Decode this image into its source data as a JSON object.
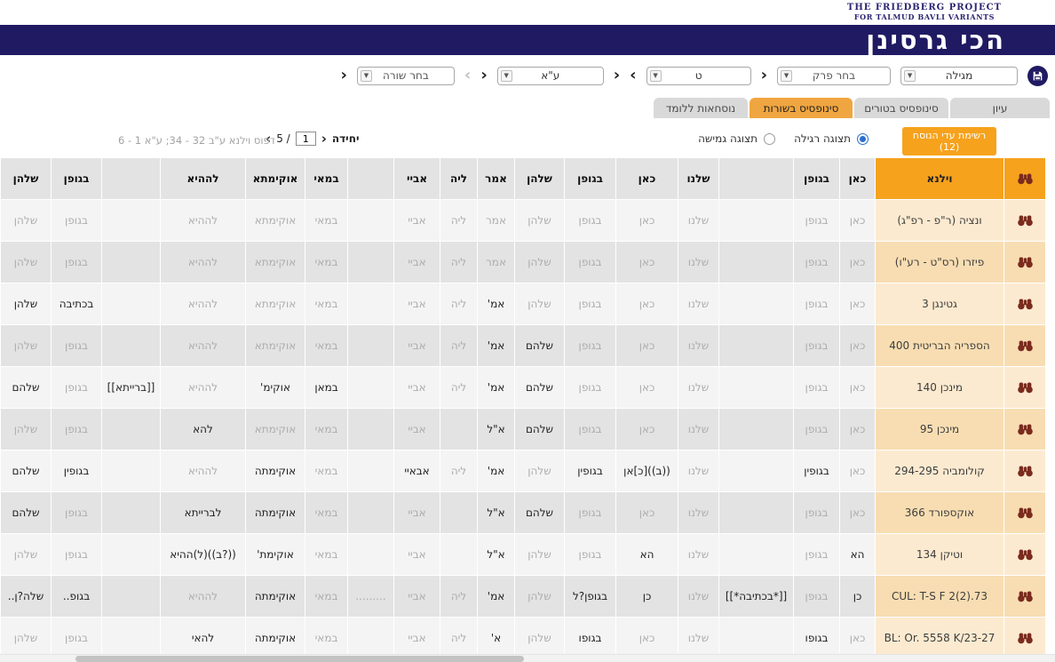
{
  "logo": {
    "line1": "THE FRIEDBERG PROJECT",
    "line2": "FOR TALMUD BAVLI VARIANTS"
  },
  "header": {
    "title": "הכי גרסינן"
  },
  "icons": {
    "chevron_left": "‹",
    "chevron_right": "›",
    "caret_down": "▼"
  },
  "toolbar": {
    "tractate": "מגילה",
    "chapter": "בחר פרק",
    "daf": "ט",
    "amud": "ע\"א",
    "line": "בחר שורה"
  },
  "tabs": [
    {
      "label": "עיון",
      "active": false
    },
    {
      "label": "סינופסיס בטורים",
      "active": false
    },
    {
      "label": "סינופסיס בשורות",
      "active": true
    },
    {
      "label": "נוסחאות ללומד",
      "active": false
    }
  ],
  "controls": {
    "witnesses_button_label": "רשימת עדי הנוסח",
    "witnesses_count": "(12)",
    "view_regular": "תצוגה רגילה",
    "view_flexible": "תצוגה גמישה",
    "view_selected": "regular",
    "unit_label": "יחידה",
    "unit_value": "1",
    "unit_total": "/ 5",
    "print_ref": "דפוס וילנא  ע\"ב 32 - 34; ע\"א 1 - 6"
  },
  "colors": {
    "navy": "#201a63",
    "orange": "#f6a21d",
    "tab_active": "#f0a640",
    "binoculars_maroon": "#7a2b1e"
  },
  "table": {
    "rows": [
      {
        "name": "וילנא",
        "base": true,
        "cells": [
          [
            "כאן",
            1
          ],
          [
            "בגופן",
            1
          ],
          [
            "",
            0
          ],
          [
            "שלנו",
            1
          ],
          [
            "כאן",
            1
          ],
          [
            "בגופן",
            1
          ],
          [
            "שלהן",
            1
          ],
          [
            "אמר",
            1
          ],
          [
            "ליה",
            1
          ],
          [
            "אביי",
            1
          ],
          [
            "",
            0
          ],
          [
            "במאי",
            1
          ],
          [
            "אוקימתא",
            1
          ],
          [
            "לההיא",
            1
          ],
          [
            "",
            0
          ],
          [
            "בגופן",
            1
          ],
          [
            "שלהן",
            1
          ]
        ]
      },
      {
        "name": "ונציה (ר\"פ - רפ\"ג)",
        "cells": [
          [
            "כאן",
            0
          ],
          [
            "בגופן",
            0
          ],
          [
            "",
            0
          ],
          [
            "שלנו",
            0
          ],
          [
            "כאן",
            0
          ],
          [
            "בגופן",
            0
          ],
          [
            "שלהן",
            0
          ],
          [
            "אמר",
            0
          ],
          [
            "ליה",
            0
          ],
          [
            "אביי",
            0
          ],
          [
            "",
            0
          ],
          [
            "במאי",
            0
          ],
          [
            "אוקימתא",
            0
          ],
          [
            "לההיא",
            0
          ],
          [
            "",
            0
          ],
          [
            "בגופן",
            0
          ],
          [
            "שלהן",
            0
          ]
        ]
      },
      {
        "name": "פיזרו (רס\"ט - רע\"ו)",
        "cells": [
          [
            "כאן",
            0
          ],
          [
            "בגופן",
            0
          ],
          [
            "",
            0
          ],
          [
            "שלנו",
            0
          ],
          [
            "כאן",
            0
          ],
          [
            "בגופן",
            0
          ],
          [
            "שלהן",
            0
          ],
          [
            "אמר",
            0
          ],
          [
            "ליה",
            0
          ],
          [
            "אביי",
            0
          ],
          [
            "",
            0
          ],
          [
            "במאי",
            0
          ],
          [
            "אוקימתא",
            0
          ],
          [
            "לההיא",
            0
          ],
          [
            "",
            0
          ],
          [
            "בגופן",
            0
          ],
          [
            "שלהן",
            0
          ]
        ]
      },
      {
        "name": "גטינגן 3",
        "cells": [
          [
            "כאן",
            0
          ],
          [
            "בגופן",
            0
          ],
          [
            "",
            0
          ],
          [
            "שלנו",
            0
          ],
          [
            "כאן",
            0
          ],
          [
            "בגופן",
            0
          ],
          [
            "שלהן",
            0
          ],
          [
            "אמ'",
            1
          ],
          [
            "ליה",
            0
          ],
          [
            "אביי",
            0
          ],
          [
            "",
            0
          ],
          [
            "במאי",
            0
          ],
          [
            "אוקימתא",
            0
          ],
          [
            "לההיא",
            0
          ],
          [
            "",
            0
          ],
          [
            "בכתיבה",
            1
          ],
          [
            "שלהן",
            1
          ]
        ]
      },
      {
        "name": "הספריה הבריטית 400",
        "cells": [
          [
            "כאן",
            0
          ],
          [
            "בגופן",
            0
          ],
          [
            "",
            0
          ],
          [
            "שלנו",
            0
          ],
          [
            "כאן",
            0
          ],
          [
            "בגופן",
            0
          ],
          [
            "שלהם",
            1
          ],
          [
            "אמ'",
            1
          ],
          [
            "ליה",
            0
          ],
          [
            "אביי",
            0
          ],
          [
            "",
            0
          ],
          [
            "במאי",
            0
          ],
          [
            "אוקימתא",
            0
          ],
          [
            "לההיא",
            0
          ],
          [
            "",
            0
          ],
          [
            "בגופן",
            0
          ],
          [
            "שלהן",
            0
          ]
        ]
      },
      {
        "name": "מינכן 140",
        "cells": [
          [
            "כאן",
            0
          ],
          [
            "בגופן",
            0
          ],
          [
            "",
            0
          ],
          [
            "שלנו",
            0
          ],
          [
            "כאן",
            0
          ],
          [
            "בגופן",
            0
          ],
          [
            "שלהם",
            1
          ],
          [
            "אמ'",
            1
          ],
          [
            "ליה",
            0
          ],
          [
            "אביי",
            0
          ],
          [
            "",
            0
          ],
          [
            "במאן",
            1
          ],
          [
            "אוקימ'",
            1
          ],
          [
            "לההיא",
            0
          ],
          [
            "[[ברייתא]]",
            1
          ],
          [
            "בגופן",
            0
          ],
          [
            "שלהם",
            1
          ]
        ]
      },
      {
        "name": "מינכן 95",
        "cells": [
          [
            "כאן",
            0
          ],
          [
            "בגופן",
            0
          ],
          [
            "",
            0
          ],
          [
            "שלנו",
            0
          ],
          [
            "כאן",
            0
          ],
          [
            "בגופן",
            0
          ],
          [
            "שלהם",
            1
          ],
          [
            "א\"ל",
            1
          ],
          [
            "",
            0
          ],
          [
            "אביי",
            0
          ],
          [
            "",
            0
          ],
          [
            "במאי",
            0
          ],
          [
            "אוקימתא",
            0
          ],
          [
            "להא",
            1
          ],
          [
            "",
            0
          ],
          [
            "בגופן",
            0
          ],
          [
            "שלהן",
            0
          ]
        ]
      },
      {
        "name": "קולומביה 294-295",
        "cells": [
          [
            "כאן",
            0
          ],
          [
            "בגופין",
            1
          ],
          [
            "",
            0
          ],
          [
            "שלנו",
            0
          ],
          [
            "((ב))[כ]אן",
            1
          ],
          [
            "בגופין",
            1
          ],
          [
            "שלהן",
            0
          ],
          [
            "אמ'",
            1
          ],
          [
            "ליה",
            0
          ],
          [
            "אבאיי",
            1
          ],
          [
            "",
            0
          ],
          [
            "במאי",
            0
          ],
          [
            "אוקימתה",
            1
          ],
          [
            "לההיא",
            0
          ],
          [
            "",
            0
          ],
          [
            "בגופין",
            1
          ],
          [
            "שלהם",
            1
          ]
        ]
      },
      {
        "name": "אוקספורד 366",
        "cells": [
          [
            "כאן",
            0
          ],
          [
            "בגופן",
            0
          ],
          [
            "",
            0
          ],
          [
            "שלנו",
            0
          ],
          [
            "כאן",
            0
          ],
          [
            "בגופן",
            0
          ],
          [
            "שלהם",
            1
          ],
          [
            "א\"ל",
            1
          ],
          [
            "",
            0
          ],
          [
            "אביי",
            0
          ],
          [
            "",
            0
          ],
          [
            "במאי",
            0
          ],
          [
            "אוקימתה",
            1
          ],
          [
            "לברייתא",
            1
          ],
          [
            "",
            0
          ],
          [
            "בגופן",
            0
          ],
          [
            "שלהם",
            1
          ]
        ]
      },
      {
        "name": "וטיקן 134",
        "cells": [
          [
            "הא",
            1
          ],
          [
            "בגופן",
            0
          ],
          [
            "",
            0
          ],
          [
            "שלנו",
            0
          ],
          [
            "הא",
            1
          ],
          [
            "בגופן",
            0
          ],
          [
            "שלהן",
            0
          ],
          [
            "א\"ל",
            1
          ],
          [
            "",
            0
          ],
          [
            "אביי",
            0
          ],
          [
            "",
            0
          ],
          [
            "במאי",
            0
          ],
          [
            "אוקימת'",
            1
          ],
          [
            "((?ב))(ל)ההיא",
            1
          ],
          [
            "",
            0
          ],
          [
            "בגופן",
            0
          ],
          [
            "שלהן",
            0
          ]
        ]
      },
      {
        "name": "CUL: T-S F 2(2).73",
        "cells": [
          [
            "כן",
            1
          ],
          [
            "בגופן",
            0
          ],
          [
            "[[*בכתיבה*]]",
            1
          ],
          [
            "שלנו",
            0
          ],
          [
            "כן",
            1
          ],
          [
            "בגופן?ל",
            1
          ],
          [
            "שלהן",
            0
          ],
          [
            "אמ'",
            1
          ],
          [
            "ליה",
            0
          ],
          [
            "אביי",
            0
          ],
          [
            ".........",
            0
          ],
          [
            "במאי",
            0
          ],
          [
            "אוקימתה",
            1
          ],
          [
            "לההיא",
            0
          ],
          [
            "",
            0
          ],
          [
            "בגופ..",
            1
          ],
          [
            "שלה?ן..",
            1
          ]
        ]
      },
      {
        "name": "BL: Or. 5558 K/23-27",
        "cells": [
          [
            "כאן",
            0
          ],
          [
            "בגופו",
            1
          ],
          [
            "",
            0
          ],
          [
            "שלנו",
            0
          ],
          [
            "כאן",
            0
          ],
          [
            "בגופו",
            1
          ],
          [
            "שלהן",
            0
          ],
          [
            "א'",
            1
          ],
          [
            "ליה",
            0
          ],
          [
            "אביי",
            0
          ],
          [
            "",
            0
          ],
          [
            "במאי",
            0
          ],
          [
            "אוקימתה",
            1
          ],
          [
            "להאי",
            1
          ],
          [
            "",
            0
          ],
          [
            "בגופן",
            0
          ],
          [
            "שלהן",
            0
          ]
        ]
      }
    ]
  }
}
